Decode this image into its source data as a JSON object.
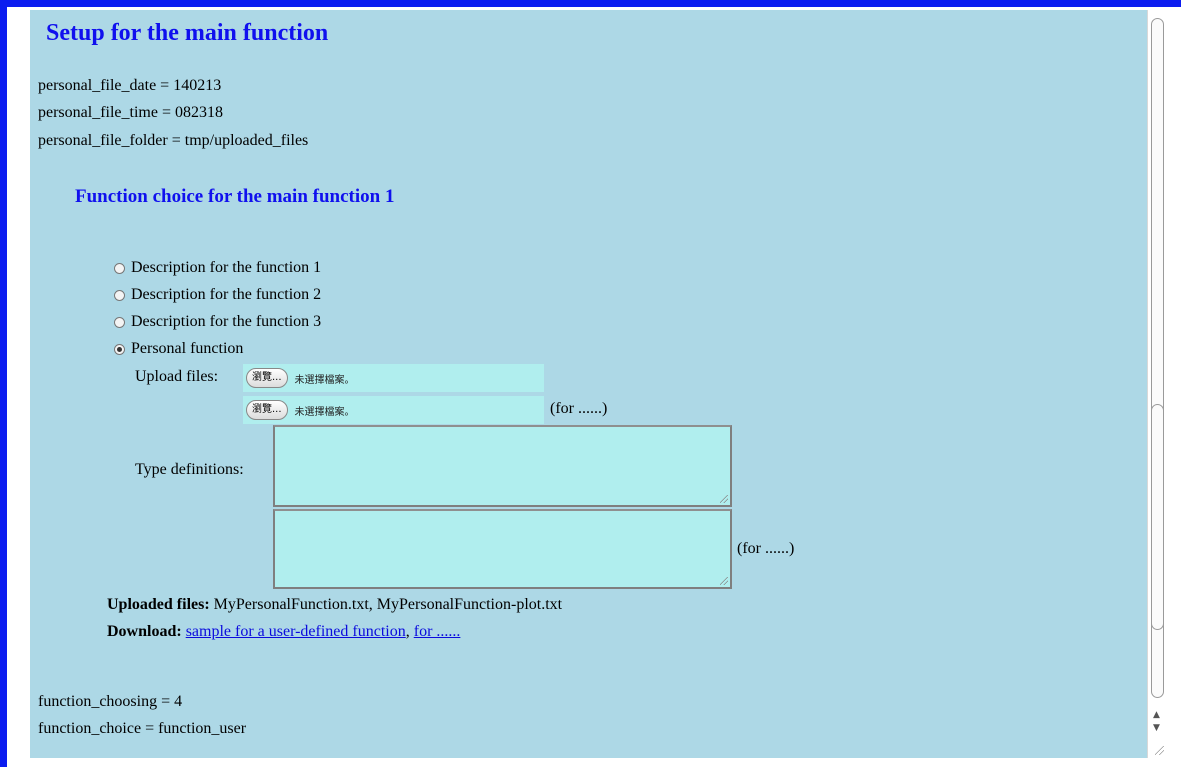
{
  "page": {
    "title": "Setup for the main function",
    "info_top": [
      "personal_file_date = 140213",
      "personal_file_time = 082318",
      "personal_file_folder = tmp/uploaded_files"
    ],
    "section_title": "Function choice for the main function 1",
    "radio_options": [
      {
        "label": "Description for the function 1",
        "checked": false
      },
      {
        "label": "Description for the function 2",
        "checked": false
      },
      {
        "label": "Description for the function 3",
        "checked": false
      },
      {
        "label": "Personal function",
        "checked": true
      }
    ],
    "upload_label": "Upload files:",
    "browse_button": "瀏覽...",
    "no_file": "未選擇檔案。",
    "for_note": "(for ......)",
    "type_def_label": "Type definitions:",
    "uploaded_label": "Uploaded files:",
    "uploaded_value": "MyPersonalFunction.txt, MyPersonalFunction-plot.txt",
    "download_label": "Download:",
    "download_link1": "sample for a user-defined function",
    "download_sep": ",",
    "download_link2": "for ......",
    "info_bottom": [
      "function_choosing = 4",
      "function_choice = function_user"
    ]
  },
  "colors": {
    "background": "#add8e6",
    "heading": "#1010ee",
    "frame": "#0b1cf0",
    "field": "#b0eeee"
  },
  "scrollbar": {
    "up_icon": "arrow-up-icon",
    "down_icon": "arrow-down-icon"
  }
}
